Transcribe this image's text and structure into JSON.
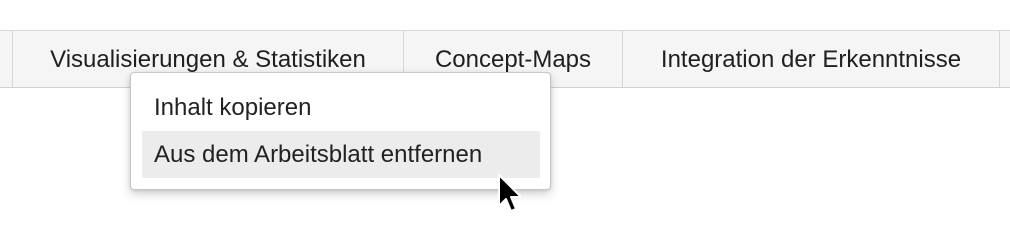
{
  "tabs": [
    {
      "label": ""
    },
    {
      "label": "Visualisierungen & Statistiken"
    },
    {
      "label": "Concept-Maps"
    },
    {
      "label": "Integration der Erkenntnisse"
    }
  ],
  "context_menu": {
    "items": [
      {
        "label": "Inhalt kopieren"
      },
      {
        "label": "Aus dem Arbeitsblatt entfernen",
        "hovered": true
      }
    ]
  },
  "colors": {
    "tabbar_bg": "#f5f5f5",
    "menu_hover_bg": "#ececec",
    "text": "#222222"
  },
  "icons": {
    "cursor": "mouse-pointer-icon"
  }
}
